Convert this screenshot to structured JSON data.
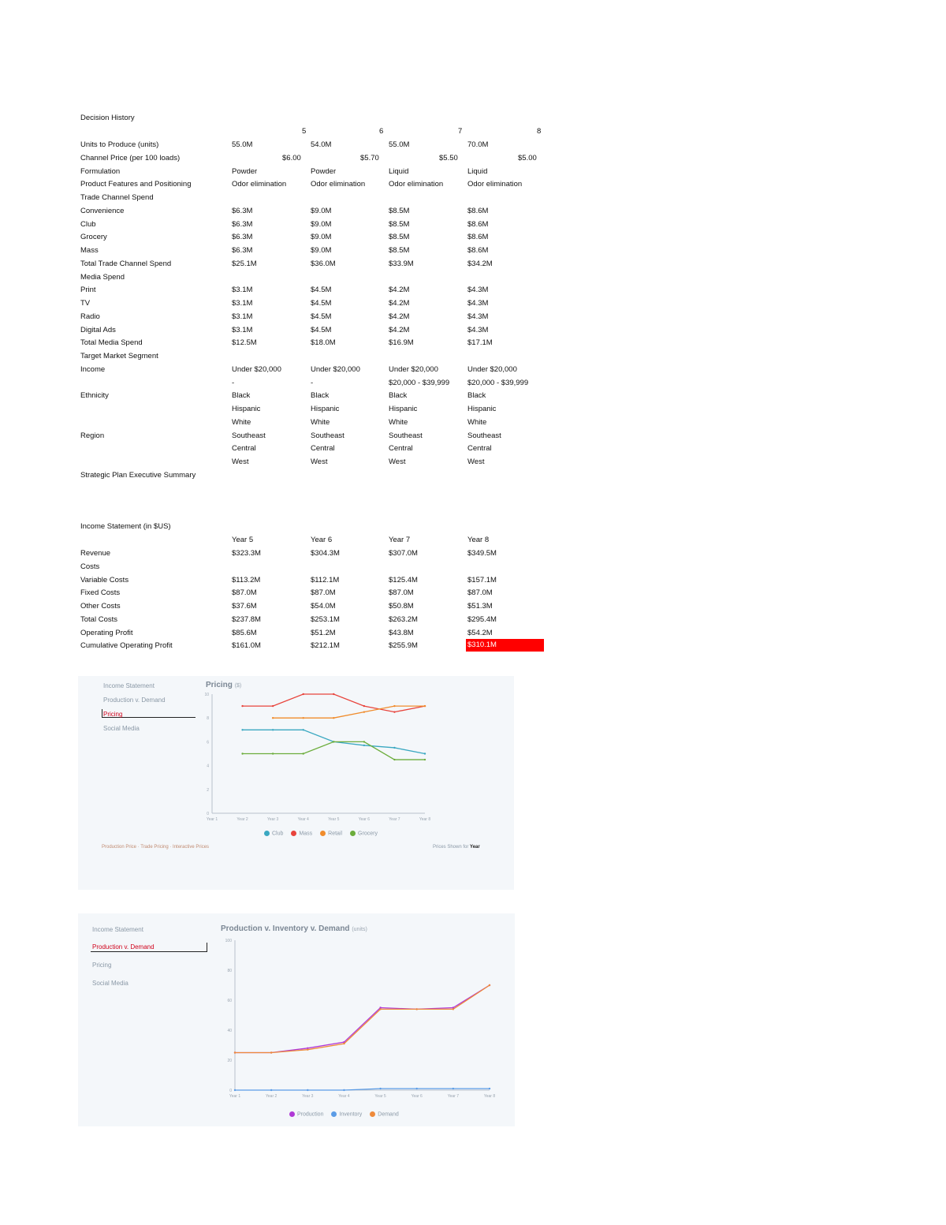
{
  "decision_history": {
    "title": "Decision History",
    "years": [
      "5",
      "6",
      "7",
      "8"
    ],
    "rows": [
      {
        "label": "Units to Produce (units)",
        "values": [
          "55.0M",
          "54.0M",
          "55.0M",
          "70.0M"
        ]
      },
      {
        "label": "Channel Price (per 100 loads)",
        "values": [
          "$6.00",
          "$5.70",
          "$5.50",
          "$5.00"
        ]
      },
      {
        "label": "Formulation",
        "values": [
          "Powder",
          "Powder",
          "Liquid",
          "Liquid"
        ]
      },
      {
        "label": "Product Features and Positioning",
        "values": [
          "Odor elimination",
          "Odor elimination",
          "Odor elimination",
          "Odor elimination"
        ]
      },
      {
        "label": "Trade Channel Spend",
        "values": [
          "",
          "",
          "",
          ""
        ]
      },
      {
        "label": "Convenience",
        "values": [
          "$6.3M",
          "$9.0M",
          "$8.5M",
          "$8.6M"
        ]
      },
      {
        "label": "Club",
        "values": [
          "$6.3M",
          "$9.0M",
          "$8.5M",
          "$8.6M"
        ]
      },
      {
        "label": "Grocery",
        "values": [
          "$6.3M",
          "$9.0M",
          "$8.5M",
          "$8.6M"
        ]
      },
      {
        "label": "Mass",
        "values": [
          "$6.3M",
          "$9.0M",
          "$8.5M",
          "$8.6M"
        ]
      },
      {
        "label": "Total Trade Channel Spend",
        "values": [
          "$25.1M",
          "$36.0M",
          "$33.9M",
          "$34.2M"
        ]
      },
      {
        "label": "Media Spend",
        "values": [
          "",
          "",
          "",
          ""
        ]
      },
      {
        "label": "Print",
        "values": [
          "$3.1M",
          "$4.5M",
          "$4.2M",
          "$4.3M"
        ]
      },
      {
        "label": "TV",
        "values": [
          "$3.1M",
          "$4.5M",
          "$4.2M",
          "$4.3M"
        ]
      },
      {
        "label": "Radio",
        "values": [
          "$3.1M",
          "$4.5M",
          "$4.2M",
          "$4.3M"
        ]
      },
      {
        "label": "Digital Ads",
        "values": [
          "$3.1M",
          "$4.5M",
          "$4.2M",
          "$4.3M"
        ]
      },
      {
        "label": "Total Media Spend",
        "values": [
          "$12.5M",
          "$18.0M",
          "$16.9M",
          "$17.1M"
        ]
      },
      {
        "label": "Target Market Segment",
        "values": [
          "",
          "",
          "",
          ""
        ]
      },
      {
        "label": "Income",
        "values": [
          "Under $20,000",
          "Under $20,000",
          "Under $20,000",
          "Under $20,000"
        ]
      },
      {
        "label": "",
        "values": [
          "-",
          "-",
          "$20,000 - $39,999",
          "$20,000 - $39,999"
        ]
      },
      {
        "label": "Ethnicity",
        "values": [
          "Black",
          "Black",
          "Black",
          "Black"
        ]
      },
      {
        "label": "",
        "values": [
          "Hispanic",
          "Hispanic",
          "Hispanic",
          "Hispanic"
        ]
      },
      {
        "label": "",
        "values": [
          "White",
          "White",
          "White",
          "White"
        ]
      },
      {
        "label": "Region",
        "values": [
          "Southeast",
          "Southeast",
          "Southeast",
          "Southeast"
        ]
      },
      {
        "label": "",
        "values": [
          "Central",
          "Central",
          "Central",
          "Central"
        ]
      },
      {
        "label": "",
        "values": [
          "West",
          "West",
          "West",
          "West"
        ]
      },
      {
        "label": "Strategic Plan Executive Summary",
        "values": [
          "",
          "",
          "",
          ""
        ]
      }
    ]
  },
  "income_statement": {
    "title": "Income Statement (in $US)",
    "headers": [
      "Year 5",
      "Year 6",
      "Year 7",
      "Year 8"
    ],
    "rows": [
      {
        "label": "Revenue",
        "values": [
          "$323.3M",
          "$304.3M",
          "$307.0M",
          "$349.5M"
        ]
      },
      {
        "label": "Costs",
        "values": [
          "",
          "",
          "",
          ""
        ]
      },
      {
        "label": "Variable Costs",
        "values": [
          "$113.2M",
          "$112.1M",
          "$125.4M",
          "$157.1M"
        ]
      },
      {
        "label": "Fixed Costs",
        "values": [
          "$87.0M",
          "$87.0M",
          "$87.0M",
          "$87.0M"
        ]
      },
      {
        "label": "Other Costs",
        "values": [
          "$37.6M",
          "$54.0M",
          "$50.8M",
          "$51.3M"
        ]
      },
      {
        "label": "Total Costs",
        "values": [
          "$237.8M",
          "$253.1M",
          "$263.2M",
          "$295.4M"
        ]
      },
      {
        "label": "Operating Profit",
        "values": [
          "$85.6M",
          "$51.2M",
          "$43.8M",
          "$54.2M"
        ]
      },
      {
        "label": "Cumulative Operating Profit",
        "values": [
          "$161.0M",
          "$212.1M",
          "$255.9M",
          "$310.1M"
        ]
      }
    ],
    "highlight_color": "#ff0000"
  },
  "pricing_panel": {
    "nav": [
      "Income Statement",
      "Production v. Demand",
      "Pricing",
      "Social Media"
    ],
    "active_nav": "Pricing",
    "title": "Pricing",
    "title_unit": "($)",
    "footer_left": "Production Price · Trade Pricing · Interactive Prices",
    "footer_right_prefix": "Prices Shown for",
    "footer_right_bold": "Year",
    "chart_data": {
      "type": "line",
      "categories": [
        "Year 1",
        "Year 2",
        "Year 3",
        "Year 4",
        "Year 5",
        "Year 6",
        "Year 7",
        "Year 8"
      ],
      "ylim": [
        0,
        10
      ],
      "y_ticks": [
        "0",
        "2",
        "4",
        "6",
        "8",
        "10"
      ],
      "series": [
        {
          "name": "Club",
          "color": "#3aa8c1",
          "values": [
            null,
            7.0,
            7.0,
            7.0,
            6.0,
            5.7,
            5.5,
            5.0
          ]
        },
        {
          "name": "Mass",
          "color": "#e8443c",
          "values": [
            null,
            9.0,
            9.0,
            10.0,
            10.0,
            9.0,
            8.5,
            9.0
          ]
        },
        {
          "name": "Retail",
          "color": "#f08c2c",
          "values": [
            null,
            null,
            8.0,
            8.0,
            8.0,
            8.5,
            9.0,
            9.0
          ]
        },
        {
          "name": "Grocery",
          "color": "#6cad3c",
          "values": [
            null,
            5.0,
            5.0,
            5.0,
            6.0,
            6.0,
            4.5,
            4.5
          ]
        }
      ]
    }
  },
  "production_panel": {
    "nav": [
      "Income Statement",
      "Production v. Demand",
      "Pricing",
      "Social Media"
    ],
    "active_nav": "Production v. Demand",
    "title": "Production v. Inventory v. Demand",
    "title_unit": "(units)",
    "chart_data": {
      "type": "line",
      "categories": [
        "Year 1",
        "Year 2",
        "Year 3",
        "Year 4",
        "Year 5",
        "Year 6",
        "Year 7",
        "Year 8"
      ],
      "ylim": [
        0,
        100
      ],
      "y_ticks": [
        "0",
        "20",
        "40",
        "60",
        "80",
        "100"
      ],
      "series": [
        {
          "name": "Production",
          "color": "#b039d6",
          "values": [
            25,
            25,
            28,
            32,
            55,
            54,
            55,
            70
          ]
        },
        {
          "name": "Inventory",
          "color": "#5b9ce6",
          "values": [
            0,
            0,
            0,
            0,
            1,
            1,
            1,
            1
          ]
        },
        {
          "name": "Demand",
          "color": "#ee8a3a",
          "values": [
            25,
            25,
            27,
            31,
            54,
            54,
            54,
            70
          ]
        }
      ]
    }
  }
}
